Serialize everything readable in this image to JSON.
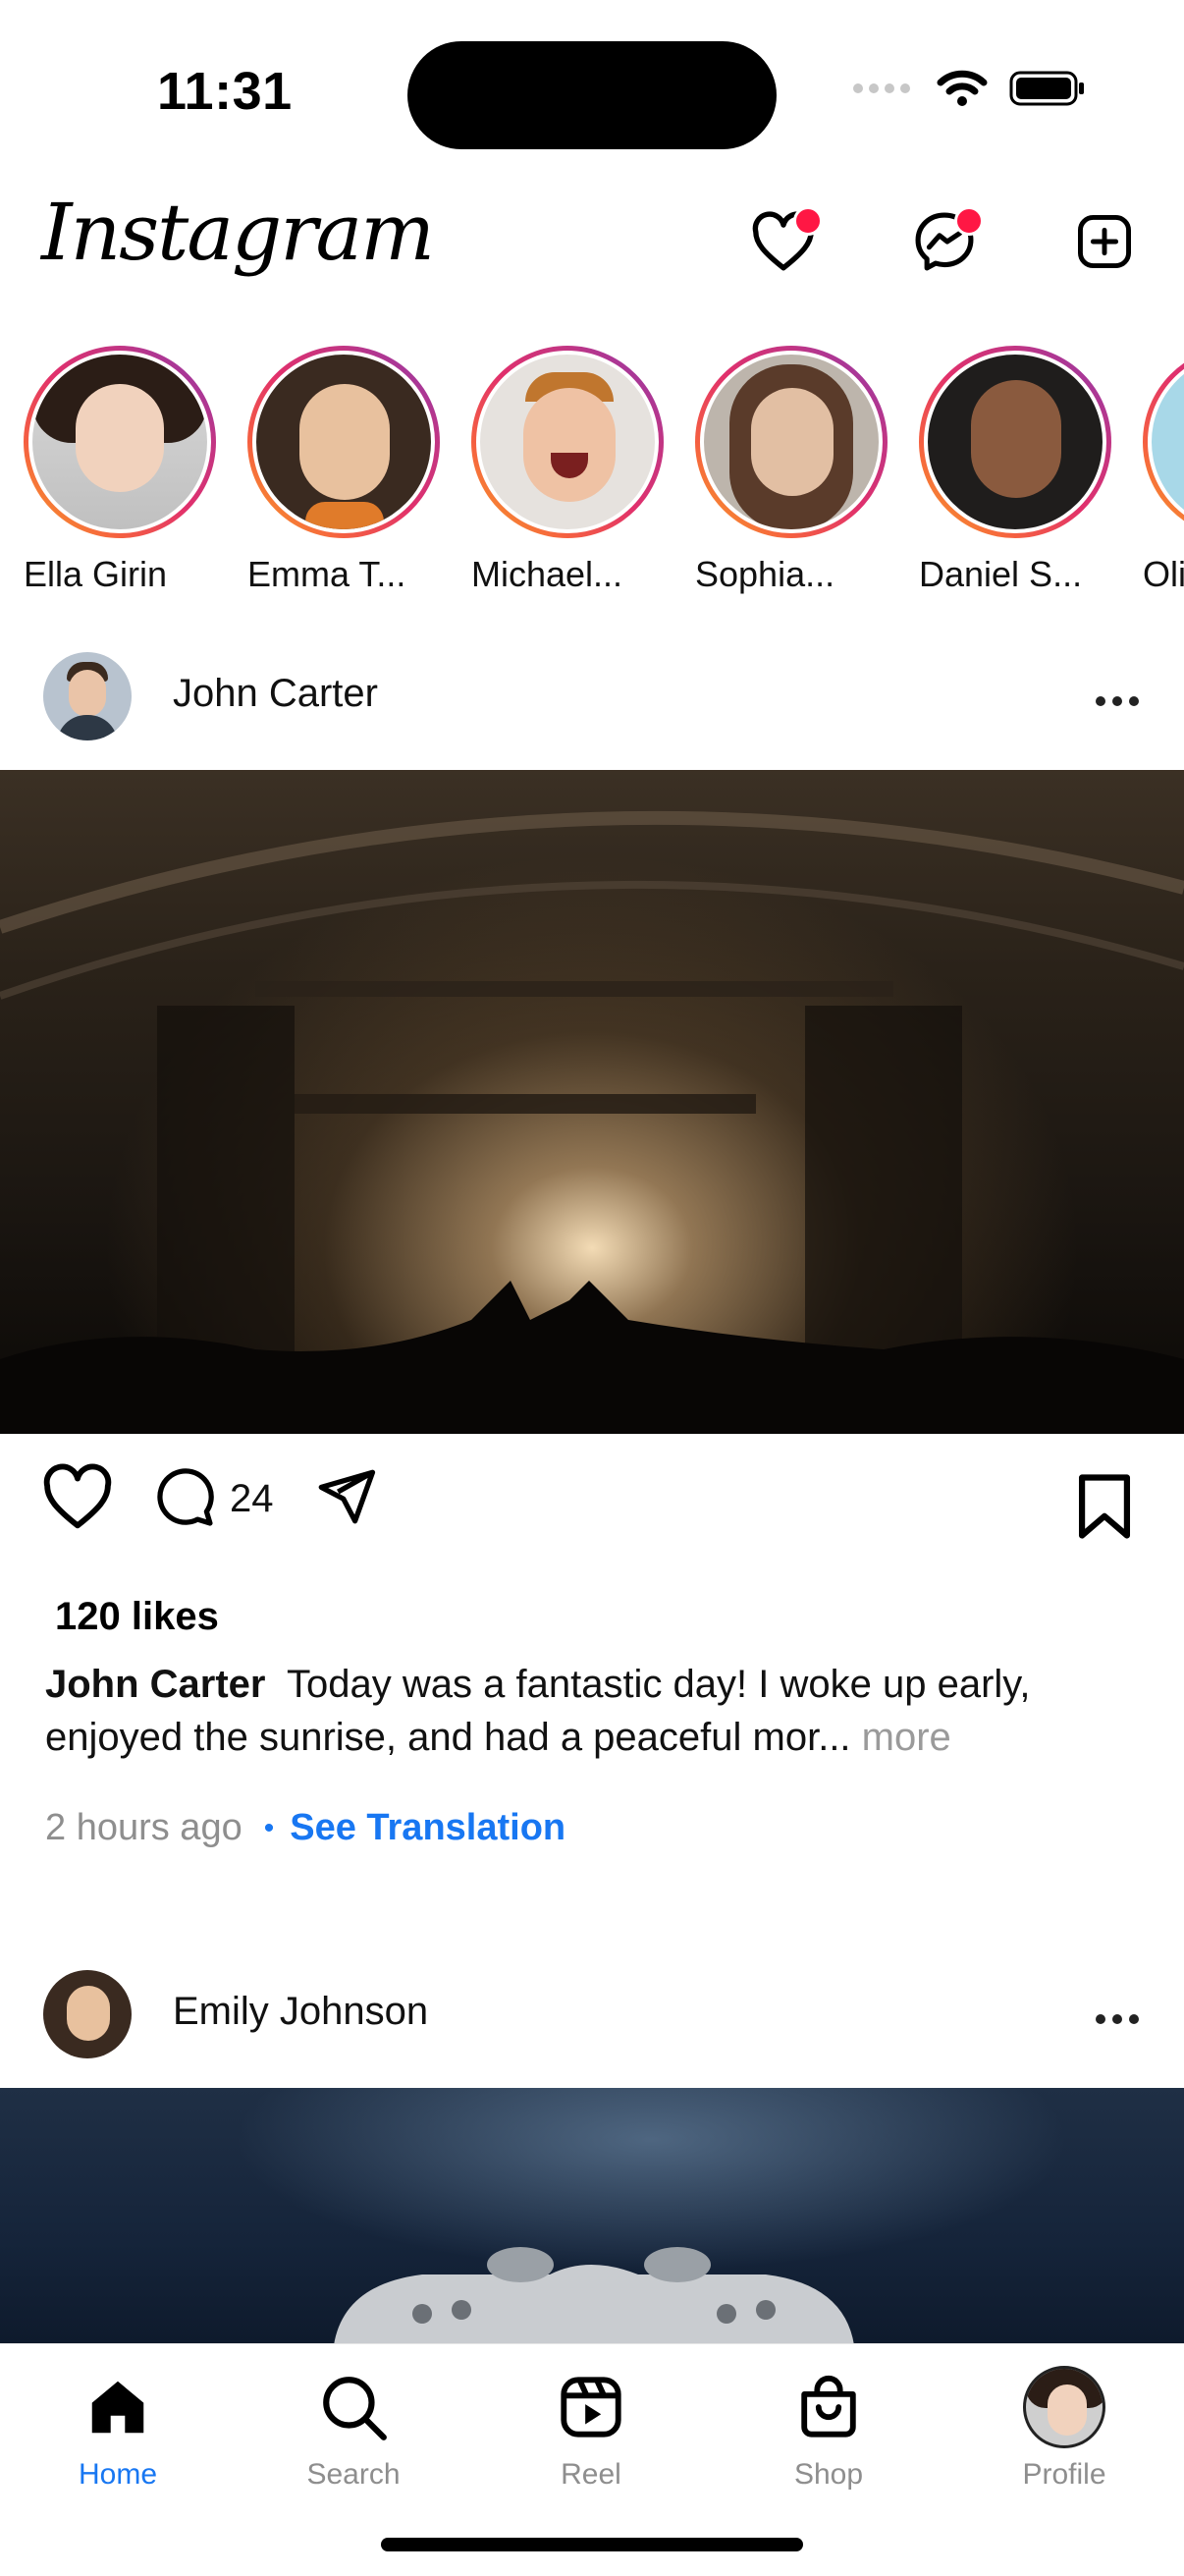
{
  "status": {
    "time": "11:31"
  },
  "header": {
    "logo": "Instagram",
    "icons": [
      "heart-icon",
      "messenger-icon",
      "add-post-icon"
    ]
  },
  "stories": [
    {
      "name": "Ella Girin"
    },
    {
      "name": "Emma T..."
    },
    {
      "name": "Michael..."
    },
    {
      "name": "Sophia..."
    },
    {
      "name": "Daniel S..."
    },
    {
      "name": "Oli"
    }
  ],
  "posts": [
    {
      "user": "John Carter",
      "comments": "24",
      "likes": "120 likes",
      "caption_user": "John Carter",
      "caption_text": "Today was a fantastic day! I woke up early, enjoyed the sunrise, and had a peaceful mor...",
      "more": "more",
      "time": "2 hours ago",
      "separator": "•",
      "translate": "See Translation"
    },
    {
      "user": "Emily Johnson"
    }
  ],
  "tabs": [
    {
      "label": "Home",
      "active": true
    },
    {
      "label": "Search"
    },
    {
      "label": "Reel"
    },
    {
      "label": "Shop"
    },
    {
      "label": "Profile"
    }
  ],
  "colors": {
    "accent": "#1877f2",
    "notification": "#ff1744",
    "muted": "#8e8e8e"
  }
}
